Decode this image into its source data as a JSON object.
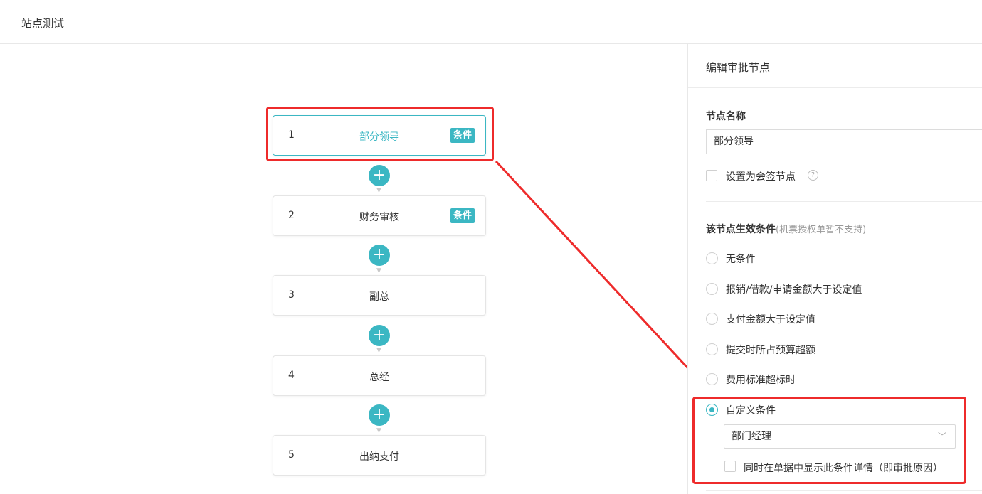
{
  "header": {
    "title": "站点测试"
  },
  "flow": {
    "nodes": [
      {
        "num": "1",
        "name": "部分领导",
        "tag": "条件",
        "active": true
      },
      {
        "num": "2",
        "name": "财务审核",
        "tag": "条件",
        "active": false
      },
      {
        "num": "3",
        "name": "副总",
        "tag": "",
        "active": false
      },
      {
        "num": "4",
        "name": "总经",
        "tag": "",
        "active": false
      },
      {
        "num": "5",
        "name": "出纳支付",
        "tag": "",
        "active": false
      }
    ],
    "add_icon": "plus-icon"
  },
  "panel": {
    "title": "编辑审批节点",
    "node_name_label": "节点名称",
    "node_name_value": "部分领导",
    "countersign_label": "设置为会签节点",
    "help_glyph": "?",
    "condition_label": "该节点生效条件",
    "condition_note": "(机票授权单暂不支持)",
    "options": [
      {
        "label": "无条件",
        "checked": false
      },
      {
        "label": "报销/借款/申请金额大于设定值",
        "checked": false
      },
      {
        "label": "支付金额大于设定值",
        "checked": false
      },
      {
        "label": "提交时所占预算超额",
        "checked": false
      },
      {
        "label": "费用标准超标时",
        "checked": false
      },
      {
        "label": "自定义条件",
        "checked": true
      }
    ],
    "custom_select_value": "部门经理",
    "show_detail_label": "同时在单据中显示此条件详情（即审批原因）"
  },
  "colors": {
    "accent": "#3bb7c3",
    "highlight": "#ee2b2b"
  }
}
